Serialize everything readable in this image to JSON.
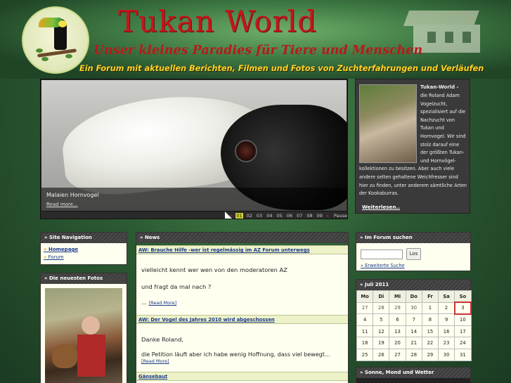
{
  "header": {
    "title": "Tukan World",
    "subtitle": "Unser kleines Paradies für Tiere und Menschen",
    "tagline": "Ein Forum mit aktuellen Berichten, Filmen und Fotos von Zuchterfahrungen und Verläufen"
  },
  "slider": {
    "caption_title": "Malaien Hornvogel",
    "caption_more": "Read more...",
    "prev_arrow": "«",
    "next_arrow": "»",
    "pages": [
      "01",
      "02",
      "03",
      "04",
      "05",
      "06",
      "07",
      "08",
      "09"
    ],
    "active_page": "01",
    "pause_label": "Pause"
  },
  "bio": {
    "heading": "Tukan-World -",
    "text": "die Roland Adam Vogelzucht, spezialisiert auf die Nachzucht von Tukan und Hornvogel. Wir sind stolz darauf eine der größten Tukan- und Hornvögel-kollektionen zu besitzen. Aber auch viele andere selten gehaltene Weichfresser sind hier zu finden, unter anderem sämtliche Arten der Kookaburras.",
    "more_label": "Weiterlesen.."
  },
  "site_nav": {
    "heading": "» Site Navigation",
    "items": [
      {
        "label": "Homepage"
      },
      {
        "label": "Forum"
      }
    ]
  },
  "photos": {
    "heading": "» Die neuesten Fotos"
  },
  "news": {
    "heading": "» News",
    "items": [
      {
        "title": "AW: Brauche Hilfe -wer ist regelmässig im AZ Forum unterwegs",
        "line1": "vielleicht kennt wer wen von den moderatoren AZ",
        "line2": "und fragt da mal nach ?",
        "ellipsis": "...",
        "more": "[Read More]"
      },
      {
        "title": "AW: Der Vogel des Jahres 2010 wird abgeschossen",
        "line1": "Danke Roland,",
        "line2": "die Petition läuft aber ich habe wenig Hoffnung, dass viel bewegt...",
        "more": "[Read More]"
      },
      {
        "title": "Gänsebaut"
      }
    ]
  },
  "search": {
    "heading": "» Im Forum suchen",
    "button": "Los",
    "placeholder": "",
    "advanced": "Erweiterte Suche"
  },
  "calendar": {
    "heading": "» Juli 2011",
    "weekdays": [
      "Mo",
      "Di",
      "Mi",
      "Do",
      "Fr",
      "Sa",
      "So"
    ],
    "weeks": [
      [
        "27",
        "28",
        "29",
        "30",
        "1",
        "2",
        "3"
      ],
      [
        "4",
        "5",
        "6",
        "7",
        "8",
        "9",
        "10"
      ],
      [
        "11",
        "12",
        "13",
        "14",
        "15",
        "16",
        "17"
      ],
      [
        "18",
        "19",
        "20",
        "21",
        "22",
        "23",
        "24"
      ],
      [
        "25",
        "26",
        "27",
        "28",
        "29",
        "30",
        "31"
      ]
    ],
    "today": "3"
  },
  "weather": {
    "heading": "» Sonne, Mond und Wetter"
  },
  "colors": {
    "title_red": "#c4161a",
    "tagline_yellow": "#ffd329",
    "link_blue": "#1b3a8a",
    "page_green": "#2c5b33"
  }
}
